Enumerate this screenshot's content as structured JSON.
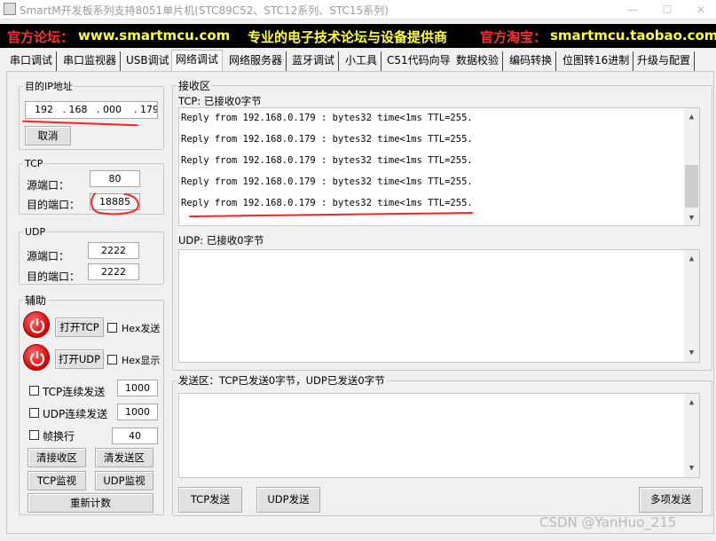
{
  "window": {
    "title": "SmartM开发板系列支持8051单片机(STC89C52、STC12系列、STC15系列)",
    "minimize_glyph": "—",
    "maximize_glyph": "☐",
    "close_glyph": "✕"
  },
  "banner": {
    "forum_label": "官方论坛：",
    "forum_url": "www.smartmcu.com",
    "slogan": "专业的电子技术论坛与设备提供商",
    "shop_label": "官方淘宝：",
    "shop_url": "smartmcu.taobao.com"
  },
  "tabs": [
    {
      "label": "串口调试"
    },
    {
      "label": "串口监视器"
    },
    {
      "label": "USB调试"
    },
    {
      "label": "网络调试"
    },
    {
      "label": "网络服务器"
    },
    {
      "label": "蓝牙调试"
    },
    {
      "label": "小工具"
    },
    {
      "label": "C51代码向导"
    },
    {
      "label": "数据校验"
    },
    {
      "label": "编码转换"
    },
    {
      "label": "位图转16进制"
    },
    {
      "label": "升级与配置"
    }
  ],
  "target_ip": {
    "legend": "目的IP地址",
    "octet1": "192",
    "octet2": "168",
    "octet3": "000",
    "octet4": "179",
    "dot": ".",
    "cancel_label": "取消"
  },
  "tcp": {
    "legend": "TCP",
    "src_port_label": "源端口：",
    "src_port": "80",
    "dst_port_label": "目的端口：",
    "dst_port": "18885"
  },
  "udp": {
    "legend": "UDP",
    "src_port_label": "源端口：",
    "src_port": "2222",
    "dst_port_label": "目的端口：",
    "dst_port": "2222"
  },
  "aux": {
    "legend": "辅助",
    "open_tcp_label": "打开TCP",
    "hex_send_label": "Hex发送",
    "open_udp_label": "打开UDP",
    "hex_display_label": "Hex显示",
    "tcp_repeat_label": "TCP连续发送",
    "tcp_repeat_value": "1000",
    "udp_repeat_label": "UDP连续发送",
    "udp_repeat_value": "1000",
    "frame_wrap_label": "帧换行",
    "frame_wrap_value": "40",
    "clear_rx_label": "清接收区",
    "clear_tx_label": "清发送区",
    "tcp_monitor_label": "TCP监视",
    "udp_monitor_label": "UDP监视",
    "reset_count_label": "重新计数"
  },
  "receive": {
    "legend": "接收区",
    "tcp_header": "TCP: 已接收0字节",
    "tcp_lines": [
      "Reply from 192.168.0.179 : bytes32 time<1ms TTL=255.",
      "Reply from 192.168.0.179 : bytes32 time<1ms TTL=255.",
      "Reply from 192.168.0.179 : bytes32 time<1ms TTL=255.",
      "Reply from 192.168.0.179 : bytes32 time<1ms TTL=255.",
      "Reply from 192.168.0.179 : bytes32 time<1ms TTL=255."
    ],
    "udp_header": "UDP: 已接收0字节"
  },
  "send": {
    "legend": "发送区：TCP已发送0字节，UDP已发送0字节",
    "tcp_send_label": "TCP发送",
    "udp_send_label": "UDP发送",
    "multi_send_label": "多项发送"
  },
  "watermark": "CSDN @YanHuo_215",
  "colors": {
    "banner_bg": "#000000",
    "banner_red": "#ff3030",
    "banner_yellow": "#ffff40",
    "annotation_red": "#ff2020",
    "power_button": "#d60000"
  }
}
